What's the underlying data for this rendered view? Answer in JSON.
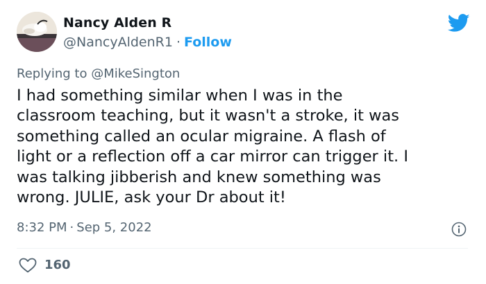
{
  "author": {
    "display_name": "Nancy Alden R",
    "handle": "@NancyAldenR1",
    "separator": "·",
    "follow_label": "Follow"
  },
  "reply": {
    "prefix": "Replying to ",
    "mention": "@MikeSington"
  },
  "tweet": {
    "text": "I had something similar when I was in the\nclassroom teaching, but it wasn't a stroke, it was\nsomething called an ocular migraine. A flash of\nlight or a reflection off a car mirror can trigger it. I\nwas talking jibberish and knew something was\nwrong. JULIE, ask your Dr about it!"
  },
  "meta": {
    "time": "8:32 PM",
    "separator": "·",
    "date": "Sep 5, 2022"
  },
  "engagement": {
    "likes": "160"
  },
  "icons": {
    "logo": "twitter-bird-icon",
    "info": "info-icon",
    "like": "heart-icon"
  },
  "colors": {
    "accent": "#1d9bf0",
    "text": "#0f1419",
    "secondary_text": "#536471",
    "divider": "#eff3f4"
  }
}
